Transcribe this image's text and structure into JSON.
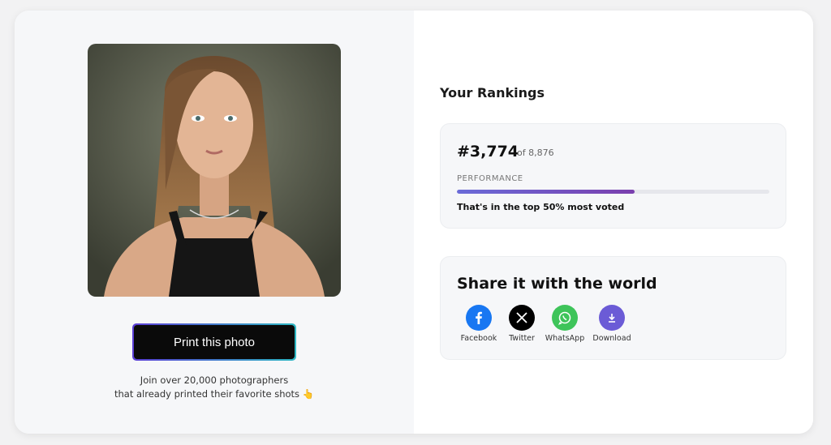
{
  "left": {
    "print_button_label": "Print this photo",
    "join_line1": "Join over 20,000 photographers",
    "join_line2": "that already printed their favorite shots 👆"
  },
  "rankings": {
    "title": "Your Rankings",
    "rank": "#3,774",
    "of_total": "of 8,876",
    "performance_label": "PERFORMANCE",
    "performance_fraction": 0.57,
    "note": "That's in the top 50% most voted"
  },
  "share": {
    "title": "Share it with the world",
    "items": [
      {
        "label": "Facebook",
        "icon": "facebook-icon",
        "color": "#1877f2"
      },
      {
        "label": "Twitter",
        "icon": "x-icon",
        "color": "#000000"
      },
      {
        "label": "WhatsApp",
        "icon": "whatsapp-icon",
        "color": "#3ec45a"
      },
      {
        "label": "Download",
        "icon": "download-icon",
        "color": "#6b5bd6"
      }
    ]
  }
}
